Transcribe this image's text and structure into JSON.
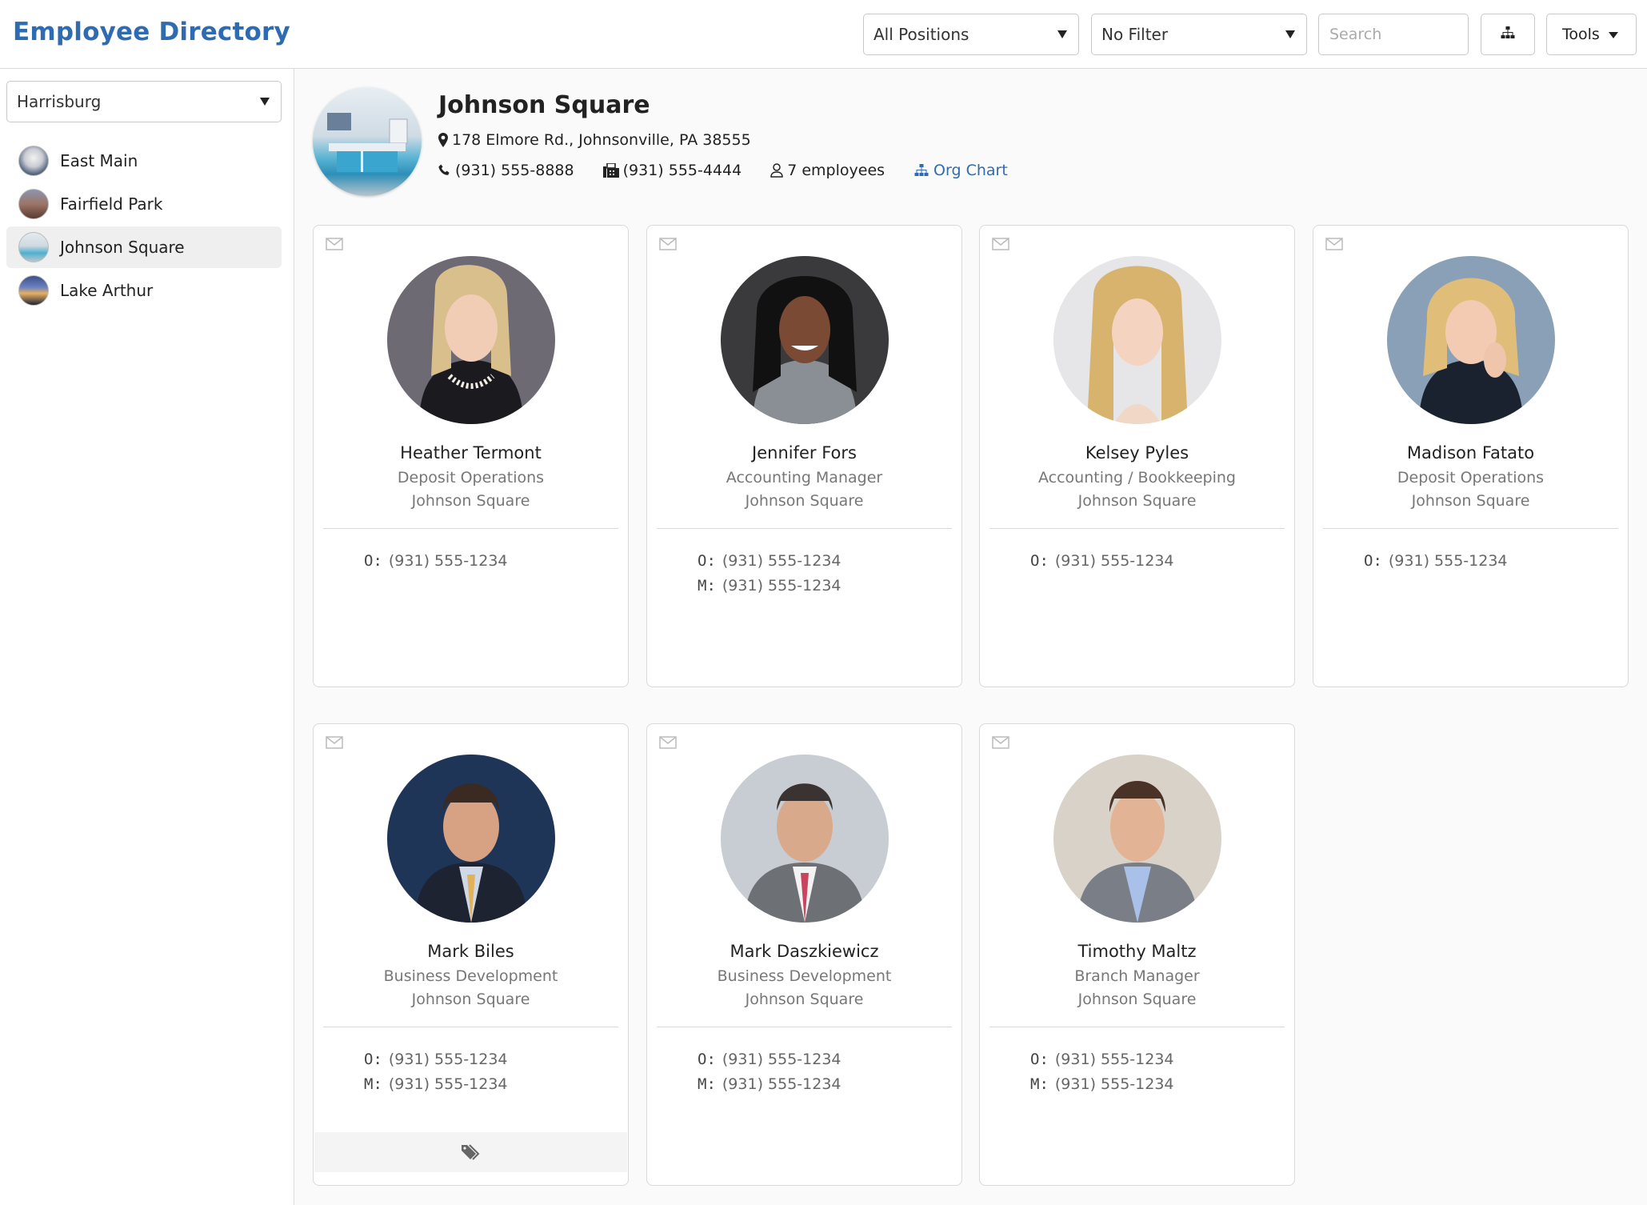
{
  "header": {
    "title": "Employee Directory",
    "positions_filter": "All Positions",
    "secondary_filter": "No Filter",
    "search_placeholder": "Search",
    "org_chart_icon": "sitemap-icon",
    "tools_label": "Tools"
  },
  "sidebar": {
    "region": "Harrisburg",
    "branches": [
      {
        "label": "East Main",
        "active": false
      },
      {
        "label": "Fairfield Park",
        "active": false
      },
      {
        "label": "Johnson Square",
        "active": true
      },
      {
        "label": "Lake Arthur",
        "active": false
      }
    ]
  },
  "location": {
    "name": "Johnson Square",
    "address": "178 Elmore Rd., Johnsonville, PA 38555",
    "phone": "(931) 555-8888",
    "fax": "(931) 555-4444",
    "employees": "7 employees",
    "org_chart_label": "Org Chart"
  },
  "employees": [
    {
      "name": "Heather Termont",
      "title": "Deposit Operations",
      "branch": "Johnson Square",
      "office_label": "O:",
      "office": "(931) 555-1234",
      "mobile_label": "",
      "mobile": ""
    },
    {
      "name": "Jennifer Fors",
      "title": "Accounting Manager",
      "branch": "Johnson Square",
      "office_label": "O:",
      "office": "(931) 555-1234",
      "mobile_label": "M:",
      "mobile": "(931) 555-1234"
    },
    {
      "name": "Kelsey Pyles",
      "title": "Accounting / Bookkeeping",
      "branch": "Johnson Square",
      "office_label": "O:",
      "office": "(931) 555-1234",
      "mobile_label": "",
      "mobile": ""
    },
    {
      "name": "Madison Fatato",
      "title": "Deposit Operations",
      "branch": "Johnson Square",
      "office_label": "O:",
      "office": "(931) 555-1234",
      "mobile_label": "",
      "mobile": ""
    },
    {
      "name": "Mark Biles",
      "title": "Business Development",
      "branch": "Johnson Square",
      "office_label": "O:",
      "office": "(931) 555-1234",
      "mobile_label": "M:",
      "mobile": "(931) 555-1234",
      "tag_icon": "tag-icon"
    },
    {
      "name": "Mark Daszkiewicz",
      "title": "Business Development",
      "branch": "Johnson Square",
      "office_label": "O:",
      "office": "(931) 555-1234",
      "mobile_label": "M:",
      "mobile": "(931) 555-1234"
    },
    {
      "name": "Timothy Maltz",
      "title": "Branch Manager",
      "branch": "Johnson Square",
      "office_label": "O:",
      "office": "(931) 555-1234",
      "mobile_label": "M:",
      "mobile": "(931) 555-1234"
    }
  ],
  "colors": {
    "brand": "#2f6bb0",
    "active_item_bg": "#efefef",
    "muted_text": "#777777"
  }
}
